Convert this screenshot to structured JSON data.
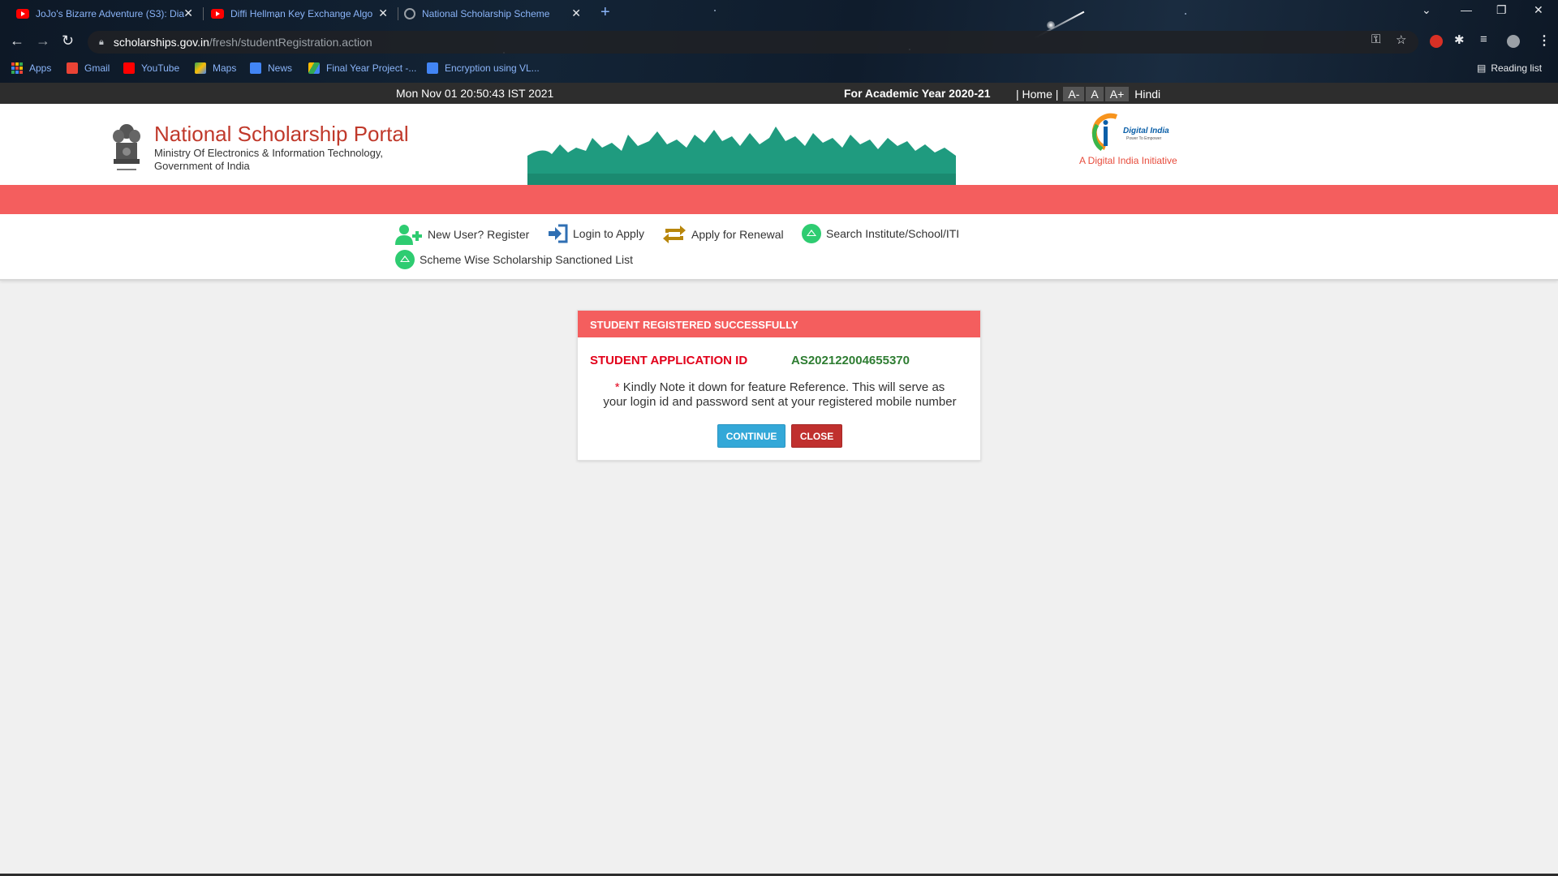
{
  "browser": {
    "tabs": [
      {
        "title": "JoJo's Bizarre Adventure (S3): Dia",
        "favicon": "youtube-icon"
      },
      {
        "title": "Diffi Hellman Key Exchange Algo",
        "favicon": "youtube-icon"
      },
      {
        "title": "National Scholarship Scheme",
        "favicon": "globe-icon"
      }
    ],
    "url_host": "scholarships.gov.in",
    "url_path": "/fresh/studentRegistration.action",
    "bookmarks": [
      {
        "label": "Apps",
        "icon": "apps-grid-icon"
      },
      {
        "label": "Gmail",
        "icon": "gmail-icon"
      },
      {
        "label": "YouTube",
        "icon": "youtube-icon"
      },
      {
        "label": "Maps",
        "icon": "maps-icon"
      },
      {
        "label": "News",
        "icon": "news-icon"
      },
      {
        "label": "Final Year Project -...",
        "icon": "drive-icon"
      },
      {
        "label": "Encryption using VL...",
        "icon": "docs-icon"
      }
    ],
    "reading_list": "Reading list"
  },
  "topbar": {
    "datetime": "Mon Nov 01 20:50:43 IST 2021",
    "academic_year": "For Academic Year 2020-21",
    "home_prefix": "| Home |",
    "font_small": "A-",
    "font_normal": "A",
    "font_large": "A+",
    "language": "Hindi"
  },
  "header": {
    "title": "National Scholarship Portal",
    "ministry_line1": "Ministry Of Electronics & Information Technology,",
    "ministry_line2": "Government of India",
    "digital_india_brand": "Digital India",
    "digital_india_tagline": "Power To Empower",
    "digital_india_caption": "A Digital India Initiative"
  },
  "nav": {
    "register": "New User? Register",
    "login": "Login to Apply",
    "renewal": "Apply for Renewal",
    "search": "Search Institute/School/ITI",
    "sanctioned": "Scheme Wise Scholarship Sanctioned List"
  },
  "panel": {
    "heading": "STUDENT REGISTERED SUCCESSFULLY",
    "app_id_label": "STUDENT APPLICATION ID",
    "app_id_value": "AS202122004655370",
    "note_asterisk": "*",
    "note_line1": "Kindly Note it down for feature Reference. This will serve as",
    "note_line2": "your login id and password sent at your registered mobile number",
    "continue_label": "CONTINUE",
    "close_label": "CLOSE"
  },
  "colors": {
    "accent_red": "#f45e5e",
    "app_id_green": "#2e7d32",
    "continue_blue": "#33a8d8",
    "close_red": "#c0302e"
  }
}
